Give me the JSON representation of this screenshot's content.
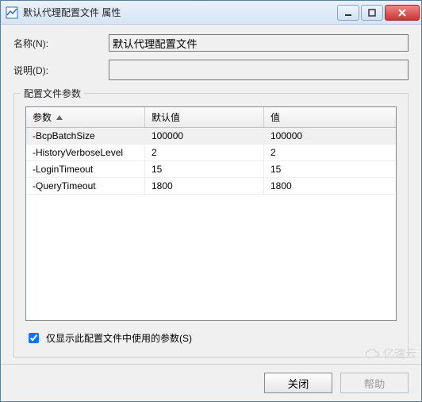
{
  "window": {
    "title": "默认代理配置文件 属性"
  },
  "form": {
    "name_label": "名称(N):",
    "name_value": "默认代理配置文件",
    "desc_label": "说明(D):",
    "desc_value": ""
  },
  "group": {
    "title": "配置文件参数",
    "columns": {
      "param": "参数",
      "default": "默认值",
      "value": "值"
    },
    "rows": [
      {
        "param": "-BcpBatchSize",
        "default": "100000",
        "value": "100000",
        "selected": true
      },
      {
        "param": "-HistoryVerboseLevel",
        "default": "2",
        "value": "2",
        "selected": false
      },
      {
        "param": "-LoginTimeout",
        "default": "15",
        "value": "15",
        "selected": false
      },
      {
        "param": "-QueryTimeout",
        "default": "1800",
        "value": "1800",
        "selected": false
      }
    ],
    "checkbox_label": "仅显示此配置文件中使用的参数(S)",
    "checkbox_checked": true
  },
  "buttons": {
    "close": "关闭",
    "help": "帮助"
  },
  "watermark": "亿速云"
}
